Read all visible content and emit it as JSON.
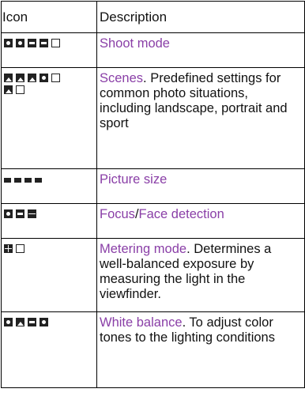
{
  "table": {
    "header_icon": "Icon",
    "header_description": "Description",
    "rows": [
      {
        "link": "Shoot mode",
        "rest": "",
        "icons": [
          "shoot-mode-icon-1",
          "shoot-mode-icon-2",
          "shoot-mode-icon-3",
          "shoot-mode-icon-4",
          "shoot-mode-icon-5"
        ]
      },
      {
        "link": "Scenes",
        "rest": ". Predefined settings for common photo situations, including landscape, portrait and sport",
        "icons": [
          "scene-icon-1",
          "scene-icon-2",
          "scene-icon-3",
          "scene-icon-4",
          "scene-icon-5",
          "scene-icon-6",
          "scene-icon-7"
        ]
      },
      {
        "link": "Picture size",
        "rest": "",
        "icons": [
          "picture-size-icon-1",
          "picture-size-icon-2",
          "picture-size-icon-3",
          "picture-size-icon-4"
        ]
      },
      {
        "link": "Focus",
        "sep": "/",
        "link2": "Face detection",
        "icons": [
          "focus-icon-1",
          "focus-icon-2",
          "focus-icon-3"
        ]
      },
      {
        "link": "Metering mode",
        "rest": ". Determines a well-balanced exposure by measuring the light in the viewfinder.",
        "icons": [
          "metering-icon-1",
          "metering-icon-2"
        ]
      },
      {
        "link": "White balance",
        "rest": ". To adjust color tones to the lighting conditions",
        "icons": [
          "white-balance-icon-1",
          "white-balance-icon-2",
          "white-balance-icon-3",
          "white-balance-icon-4"
        ]
      }
    ]
  }
}
